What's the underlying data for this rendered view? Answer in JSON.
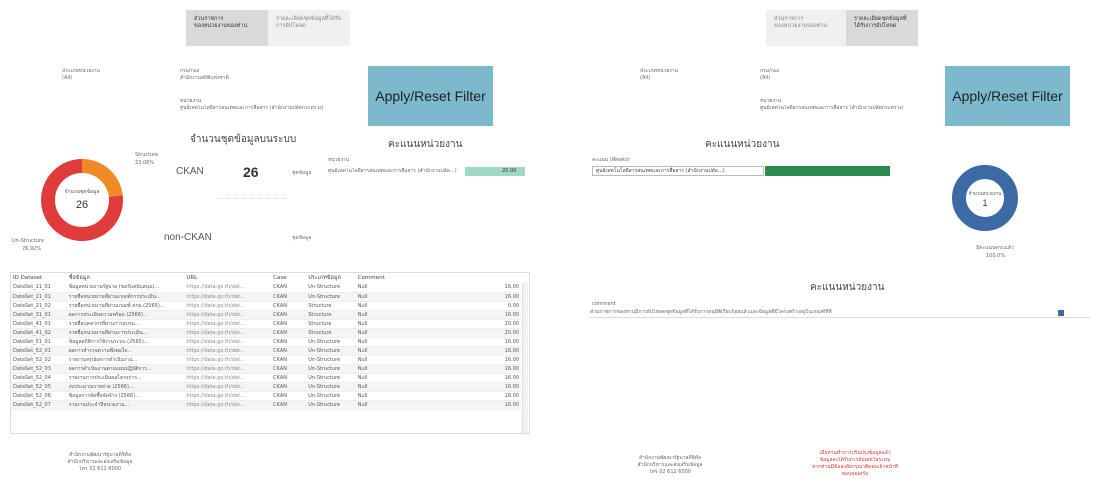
{
  "left": {
    "tabs": [
      {
        "label": "ส่วนราชการ",
        "sub": "ของหน่วยงานของท่าน"
      },
      {
        "label": "รายละเอียดชุดข้อมูลที่ได้รับการอัปโหลด",
        "sub": ""
      }
    ],
    "filters": {
      "agency_label": "ประเภทหน่วยงาน",
      "agency_value": "(All)",
      "dept_label": "กรม/กอง",
      "dept_value": "สำนักงานสถิติแห่งชาติ",
      "unit_label": "หน่วยงาน",
      "unit_value": "ศูนย์เทคโนโลยีสารสนเทศและการสื่อสาร (สำนักงานปลัดกระทรวง)"
    },
    "apply_button": "Apply/Reset Filter",
    "count_heading": "จำนวนชุดข้อมูลบนระบบ",
    "score_heading": "คะแนนหน่วยงาน",
    "ckan_label": "CKAN",
    "ckan_value": "26",
    "ckan_unit": "ชุดข้อมูล",
    "nonckan_label": "non-CKAN",
    "nonckan_unit": "ชุดข้อมูล",
    "score_row_label": "หน่วยงาน",
    "score_row_name": "ศูนย์เทคโนโลยีสารสนเทศและการสื่อสาร (สำนักงานปลัด...)",
    "score_row_value": "20.00",
    "donut": {
      "center_label": "จำนวนชุดข้อมูล",
      "center_value": "26",
      "legend_structure": "Structure",
      "legend_structure_pct": "23.08%",
      "legend_unstructure": "Un-Structure",
      "legend_unstructure_pct": "76.92%",
      "structure_fraction": 0.2308,
      "unstructure_fraction": 0.7692,
      "colors": {
        "structure": "#f08a24",
        "unstructure": "#e03c3c"
      }
    },
    "table": {
      "headers": [
        "ID Dataset",
        "ชื่อข้อมูล",
        "URL",
        "Case",
        "ประเภทข้อมูล",
        "Comment",
        ""
      ],
      "rows": [
        [
          "DataSet_11_01",
          "ข้อมูลหน่วยงานรัฐบาล (ขอรับสนับสนุน)...",
          "https://data.go.th/dat...",
          "CKAN",
          "Un-Structure",
          "Null",
          "16.00"
        ],
        [
          "DataSet_21_01",
          "รายชื่อหน่วยงานที่ผ่านเกณฑ์การประเมิน...",
          "https://data.go.th/dat...",
          "CKAN",
          "Un-Structure",
          "Null",
          "16.00"
        ],
        [
          "DataSet_21_02",
          "รายชื่อหน่วยงานที่ผ่านเกณฑ์ ครม.(2565)...",
          "https://data.go.th/dat...",
          "CKAN",
          "Structure",
          "Null",
          "0.00"
        ],
        [
          "DataSet_31_01",
          "ผลการประเมินความพร้อม (2566)...",
          "https://data.go.th/dat...",
          "CKAN",
          "Structure",
          "Null",
          "16.00"
        ],
        [
          "DataSet_41_01",
          "รายชื่อบุคลากรที่ผ่านการอบรม...",
          "https://data.go.th/dat...",
          "CKAN",
          "Structure",
          "Null",
          "20.00"
        ],
        [
          "DataSet_41_02",
          "รายชื่อหน่วยงานที่ผ่านการประเมิน...",
          "https://data.go.th/dat...",
          "CKAN",
          "Structure",
          "Null",
          "20.00"
        ],
        [
          "DataSet_51_01",
          "ข้อมูลสถิติการใช้งานระบบ (2565)...",
          "https://data.go.th/dat...",
          "CKAN",
          "Un-Structure",
          "Null",
          "16.00"
        ],
        [
          "DataSet_52_01",
          "ผลการสำรวจความพึงพอใจ...",
          "https://data.go.th/dat...",
          "CKAN",
          "Un-Structure",
          "Null",
          "16.00"
        ],
        [
          "DataSet_52_02",
          "รายงานสรุปผลการดำเนินงาน...",
          "https://data.go.th/dat...",
          "CKAN",
          "Un-Structure",
          "Null",
          "16.00"
        ],
        [
          "DataSet_52_03",
          "ผลการดำเนินงานตามแผนปฏิบัติการ...",
          "https://data.go.th/dat...",
          "CKAN",
          "Un-Structure",
          "Null",
          "16.00"
        ],
        [
          "DataSet_52_04",
          "รายงานการประเมินผลโครงการ...",
          "https://data.go.th/dat...",
          "CKAN",
          "Un-Structure",
          "Null",
          "16.00"
        ],
        [
          "DataSet_52_05",
          "งบประมาณรายจ่าย (2566)...",
          "https://data.go.th/dat...",
          "CKAN",
          "Un-Structure",
          "Null",
          "16.00"
        ],
        [
          "DataSet_52_06",
          "ข้อมูลการจัดซื้อจัดจ้าง (2566)...",
          "https://data.go.th/dat...",
          "CKAN",
          "Un-Structure",
          "Null",
          "16.00"
        ],
        [
          "DataSet_52_07",
          "รายงานประจำปีหน่วยงาน...",
          "https://data.go.th/dat...",
          "CKAN",
          "Un-Structure",
          "Null",
          "16.00"
        ]
      ]
    },
    "footer": {
      "line1": "สำนักงานพัฒนารัฐบาลดิจิทัล",
      "line2": "สำนักบริหารและส่งเสริมข้อมูล",
      "line3": "โทร 02 612 6000"
    }
  },
  "right": {
    "tabs": [
      {
        "label": "ส่วนราชการ",
        "sub": "ของหน่วยงานของท่าน"
      },
      {
        "label": "รายละเอียดชุดข้อมูลที่ได้รับการอัปโหลด",
        "sub": ""
      }
    ],
    "filters": {
      "agency_label": "ประเภทหน่วยงาน",
      "agency_value": "(All)",
      "dept_label": "กรม/กอง",
      "dept_value": "(All)",
      "unit_label": "หน่วยงาน",
      "unit_value": "ศูนย์เทคโนโลยีสารสนเทศและการสื่อสาร (สำนักงานปลัดกระทรวง)"
    },
    "apply_button": "Apply/Reset Filter",
    "score_heading": "คะแนนหน่วยงาน",
    "score_dropdown_label": "คะแนน (Weeks)",
    "score_row_name": "ศูนย์เทคโนโลยีสารสนเทศและการสื่อสาร (สำนักงานปลัด...)",
    "score_fraction": 1.0,
    "donut": {
      "center_label": "จำนวนหน่วยงาน",
      "center_value": "1",
      "legend_label": "มีคะแนนครบแล้ว",
      "legend_pct": "100.0%",
      "color": "#3c6aa4"
    },
    "score_heading2": "คะแนนหน่วยงาน",
    "comment_label": "comment",
    "comment_text": "ส่วนราชการของท่านมีการอัปโหลดชุดข้อมูลที่ได้รับการอนุมัติเรียบร้อยแล้วและข้อมูลที่มีโครงสร้างอยู่ในเกณฑ์ที่ดี",
    "footer": {
      "line1": "สำนักงานพัฒนารัฐบาลดิจิทัล",
      "line2": "สำนักบริหารและส่งเสริมข้อมูล",
      "line3": "โทร 02 612 6000"
    },
    "notice": {
      "line1": "เมื่อท่านทำการปรับปรุงข้อมูลแล้ว",
      "line2": "ข้อมูลจะได้รับการอัปเดตในระบบ",
      "line3": "หากท่านมีข้อสงสัยกรุณาติดต่อเจ้าหน้าที่",
      "line4": "ขอบคุณครับ",
      "color": "#e03030"
    }
  },
  "colors": {
    "accent_blue": "#7cb9cc",
    "score_bar_light": "#9fd8c4",
    "score_bar_dark": "#2e8b4e"
  }
}
